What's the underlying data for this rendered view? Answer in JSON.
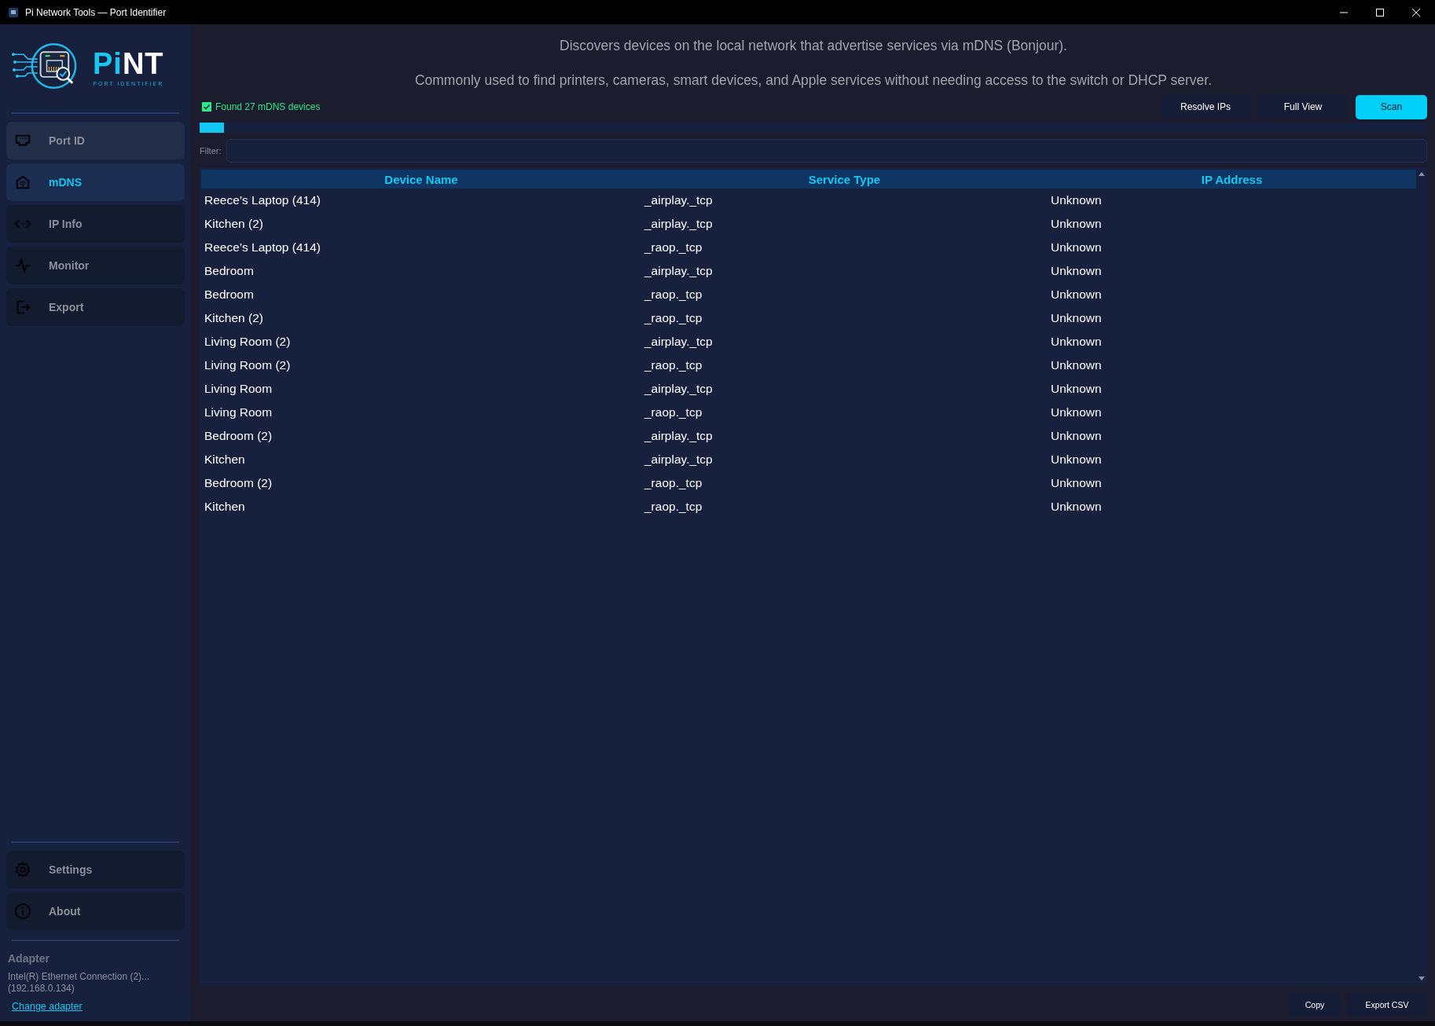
{
  "window": {
    "title": "Pi Network Tools — Port Identifier"
  },
  "logo": {
    "title_accent": "Pi",
    "title_rest": "NT",
    "subtitle": "PORT IDENTIFIER"
  },
  "sidebar": {
    "items": [
      {
        "label": "Port ID",
        "selected": false,
        "hovered": true
      },
      {
        "label": "mDNS",
        "selected": true,
        "hovered": false
      },
      {
        "label": "IP Info",
        "selected": false,
        "hovered": false
      },
      {
        "label": "Monitor",
        "selected": false,
        "hovered": false
      },
      {
        "label": "Export",
        "selected": false,
        "hovered": false
      }
    ],
    "bottom_items": [
      {
        "label": "Settings",
        "selected": false
      },
      {
        "label": "About",
        "selected": false
      }
    ],
    "adapter": {
      "heading": "Adapter",
      "name": "Intel(R) Ethernet Connection (2)...",
      "ip": "(192.168.0.134)",
      "link": "Change adapter"
    }
  },
  "header": {
    "description": "Discovers devices on the local network that advertise services via mDNS (Bonjour).",
    "note": "Commonly used to find printers, cameras, smart devices, and Apple services without needing access to the switch or DHCP server."
  },
  "status": {
    "checked": true,
    "text": "Found 27 mDNS devices"
  },
  "toolbar": {
    "buttons": [
      {
        "label": "Resolve IPs",
        "primary": false
      },
      {
        "label": "Full View",
        "primary": false
      },
      {
        "label": "Scan",
        "primary": true
      }
    ]
  },
  "progress": {
    "level": 0.02
  },
  "filter": {
    "label": "Filter:"
  },
  "table": {
    "columns": [
      "Device Name",
      "Service Type",
      "IP Address"
    ],
    "rows": [
      [
        "Reece’s Laptop (414)",
        "_airplay._tcp",
        "Unknown"
      ],
      [
        "Kitchen (2)",
        "_airplay._tcp",
        "Unknown"
      ],
      [
        "Reece’s Laptop (414)",
        "_raop._tcp",
        "Unknown"
      ],
      [
        "Bedroom",
        "_airplay._tcp",
        "Unknown"
      ],
      [
        "Bedroom",
        "_raop._tcp",
        "Unknown"
      ],
      [
        "Kitchen (2)",
        "_raop._tcp",
        "Unknown"
      ],
      [
        "Living Room (2)",
        "_airplay._tcp",
        "Unknown"
      ],
      [
        "Living Room (2)",
        "_raop._tcp",
        "Unknown"
      ],
      [
        "Living Room",
        "_airplay._tcp",
        "Unknown"
      ],
      [
        "Living Room",
        "_raop._tcp",
        "Unknown"
      ],
      [
        "Bedroom (2)",
        "_airplay._tcp",
        "Unknown"
      ],
      [
        "Kitchen",
        "_airplay._tcp",
        "Unknown"
      ],
      [
        "Bedroom (2)",
        "_raop._tcp",
        "Unknown"
      ],
      [
        "Kitchen",
        "_raop._tcp",
        "Unknown"
      ]
    ]
  },
  "footer": {
    "buttons": [
      "Copy",
      "Export CSV"
    ]
  }
}
